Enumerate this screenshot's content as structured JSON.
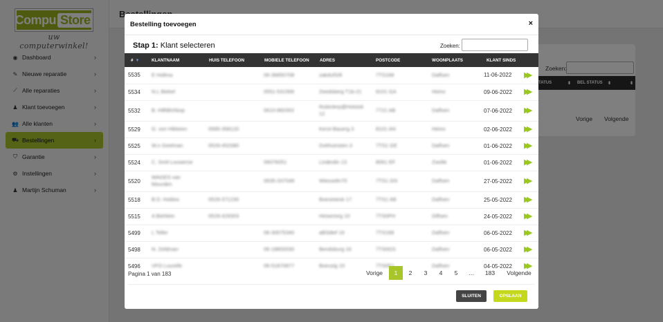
{
  "logo": {
    "brand_left": "Compu",
    "brand_right": "Store",
    "tagline": "uw computerwinkel!"
  },
  "sidebar": {
    "items": [
      {
        "label": "Dashboard",
        "icon": "palette-icon",
        "glyph": "◉"
      },
      {
        "label": "Nieuwe reparatie",
        "icon": "wrench-icon",
        "glyph": "✎"
      },
      {
        "label": "Alle reparaties",
        "icon": "screwdriver-icon",
        "glyph": "⟋"
      },
      {
        "label": "Klant toevoegen",
        "icon": "person-icon",
        "glyph": "♟"
      },
      {
        "label": "Alle klanten",
        "icon": "users-icon",
        "glyph": "👥"
      },
      {
        "label": "Bestellingen",
        "icon": "truck-icon",
        "glyph": "⛟"
      },
      {
        "label": "Garantie",
        "icon": "shield-icon",
        "glyph": "⛉"
      },
      {
        "label": "Instellingen",
        "icon": "gear-icon",
        "glyph": "⚙"
      },
      {
        "label": "Martijn Schuman",
        "icon": "person-icon",
        "glyph": "♟"
      }
    ],
    "chevron": "›",
    "active_index": 5,
    "accent": "#a8c62a"
  },
  "header": {
    "title": "Bestellingen"
  },
  "background_card": {
    "search_label": "Zoeken:",
    "col_status": "STATUS",
    "col_bel_status": "BEL STATUS",
    "prev": "Vorige",
    "next": "Volgende"
  },
  "modal": {
    "title": "Bestelling toevoegen",
    "close": "×",
    "step_prefix": "Stap 1:",
    "step_text": " Klant selecteren",
    "search_label": "Zoeken:",
    "search_value": "",
    "columns": [
      "#",
      "KLANTNAAM",
      "HUIS TELEFOON",
      "MOBIELE TELEFOON",
      "ADRES",
      "POSTCODE",
      "WOONPLAATS",
      "KLANT SINDS"
    ],
    "sort_indicator": "▼",
    "rows": [
      {
        "id": "5535",
        "name": "E Hollma",
        "home": "",
        "mobile": "06-36850708",
        "address": "zakdufS/8",
        "zip": "7TS168",
        "city": "Dalfsen",
        "since": "11-06-2022",
        "tall": false
      },
      {
        "id": "5534",
        "name": "N.L Biekel",
        "home": "",
        "mobile": "0551-531566",
        "address": "Zeedsberg T1b-21",
        "zip": "8101 GA",
        "city": "Heino",
        "since": "09-06-2022",
        "tall": false
      },
      {
        "id": "5532",
        "name": "B. Hilfdilchbop",
        "home": "",
        "mobile": "0610-882002",
        "address": "Rubinlerp@Hotsisk 12",
        "zip": "7721 AB",
        "city": "Dalfsen",
        "since": "07-06-2022",
        "tall": true
      },
      {
        "id": "5529",
        "name": "G. von Hikkeen",
        "home": "0585-358120",
        "mobile": "",
        "address": "Kerst-Bauerg 3",
        "zip": "8101 AN",
        "city": "Heino",
        "since": "02-06-2022",
        "tall": false
      },
      {
        "id": "5525",
        "name": "W.n Geelman",
        "home": "0529-452080",
        "mobile": "",
        "address": "Ovkhuinsten 3",
        "zip": "7TS1 GE",
        "city": "Dalfsen",
        "since": "01-06-2022",
        "tall": false
      },
      {
        "id": "5524",
        "name": "C. Smit-Louwerse",
        "home": "",
        "mobile": "06076051",
        "address": "Lindeslin 13",
        "zip": "8061 EF",
        "city": "Zwolle",
        "since": "01-06-2022",
        "tall": false
      },
      {
        "id": "5520",
        "name": "WAGES van Mourden",
        "home": "",
        "mobile": "0635-337048",
        "address": "Wiesselin70",
        "zip": "7TS1 GN",
        "city": "Dalfsen",
        "since": "27-05-2022",
        "tall": true
      },
      {
        "id": "5518",
        "name": "B.D. Holdos",
        "home": "0529-371230",
        "mobile": "",
        "address": "Boesiotesk 17",
        "zip": "7TS1 AB",
        "city": "Dalfsen",
        "since": "25-05-2022",
        "tall": false
      },
      {
        "id": "5515",
        "name": "A Biehlein",
        "home": "0529-429303",
        "mobile": "",
        "address": "Heiseriorg 10",
        "zip": "7TS0PH",
        "city": "Dilfsen",
        "since": "24-05-2022",
        "tall": false
      },
      {
        "id": "5499",
        "name": "L Teller",
        "home": "",
        "mobile": "06-30075340",
        "address": "aBSi8ef 16",
        "zip": "7TS168",
        "city": "Dalfsen",
        "since": "06-05-2022",
        "tall": false
      },
      {
        "id": "5498",
        "name": "N. Zeldman",
        "home": "",
        "mobile": "06-18800030",
        "address": "Bendsburg 16",
        "zip": "7TS0GS",
        "city": "Dalfsen",
        "since": "06-05-2022",
        "tall": false
      },
      {
        "id": "5496",
        "name": "VFO Luurelle",
        "home": "",
        "mobile": "06-51870877",
        "address": "Boessig 15",
        "zip": "7TS0F1",
        "city": "Dalfsen",
        "since": "04-05-2022",
        "tall": false
      }
    ],
    "go_glyph": "▶▶",
    "go_color": "#9ac81e",
    "pager": {
      "info": "Pagina 1 van 183",
      "prev": "Vorige",
      "pages": [
        "1",
        "2",
        "3",
        "4",
        "5",
        "…",
        "183"
      ],
      "current": "1",
      "next": "Volgende"
    },
    "btn_close": "SLUITEN",
    "btn_save": "OPSLAAN"
  }
}
